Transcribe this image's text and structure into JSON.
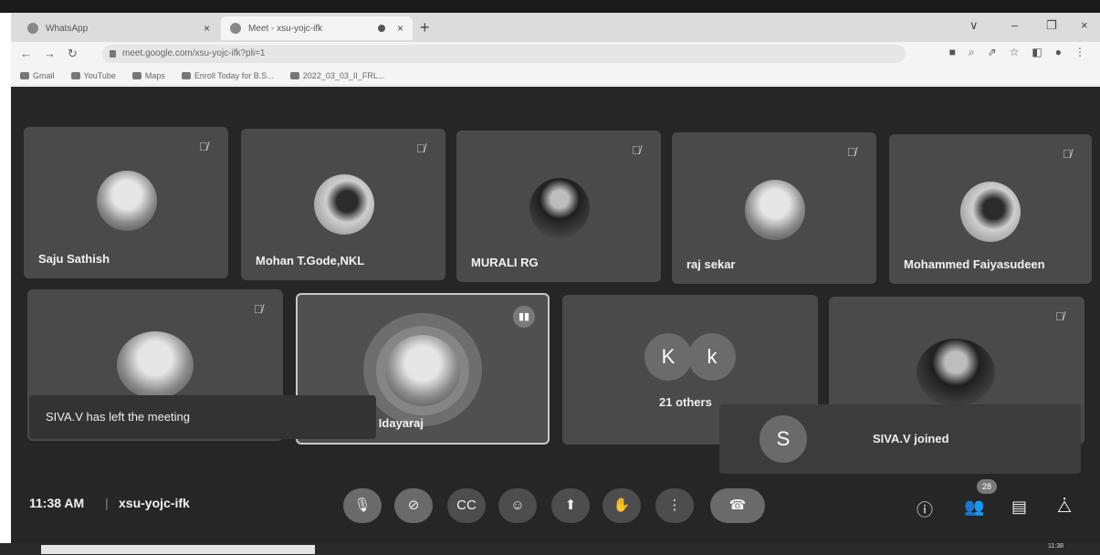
{
  "browser": {
    "tabs": [
      {
        "title": "WhatsApp",
        "close": "×"
      },
      {
        "title": "Meet - xsu-yojc-ifk",
        "close": "×"
      }
    ],
    "new_tab": "+",
    "window_controls": [
      "∨",
      "–",
      "❐",
      "×"
    ],
    "url": "meet.google.com/xsu-yojc-ifk?pli=1",
    "bookmarks": [
      "Gmail",
      "YouTube",
      "Maps",
      "Enroll Today for B.S...",
      "2022_03_03_II_FRL..."
    ]
  },
  "participants": [
    {
      "name": "Saju Sathish"
    },
    {
      "name": "Mohan T.Gode,NKL"
    },
    {
      "name": "MURALI RG"
    },
    {
      "name": "raj sekar"
    },
    {
      "name": "Mohammed Faiyasudeen"
    },
    {
      "name": ""
    },
    {
      "name": "na Idayaraj"
    },
    {
      "name": ""
    }
  ],
  "others_tile": {
    "bubble1": "K",
    "bubble2": "k",
    "label": "21 others"
  },
  "notifications": {
    "left": "SIVA.V has left the meeting",
    "right_initial": "S",
    "right": "SIVA.V joined"
  },
  "bottom_bar": {
    "time": "11:38 AM",
    "separator": "|",
    "meeting_code": "xsu-yojc-ifk",
    "people_count": "28"
  },
  "taskbar": {
    "time": "11:38"
  }
}
